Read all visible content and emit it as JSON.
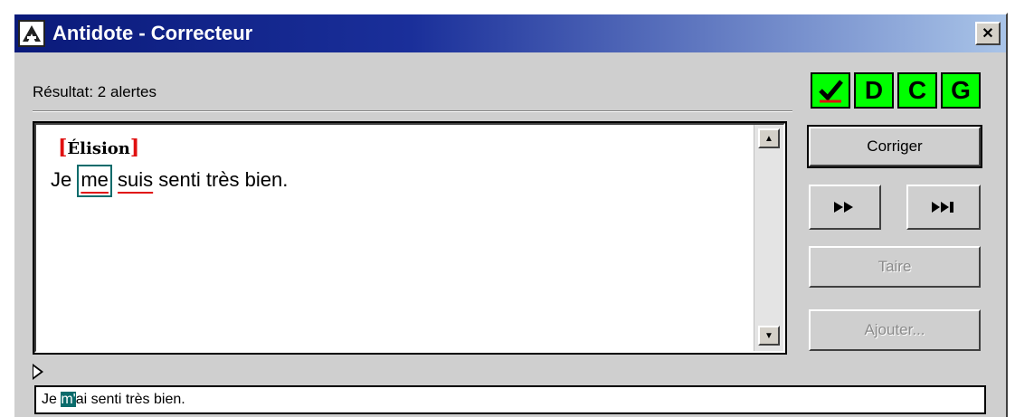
{
  "window": {
    "title": "Antidote - Correcteur",
    "close_glyph": "✕"
  },
  "result": {
    "label": "Résultat: 2 alertes"
  },
  "mode_buttons": [
    {
      "label": "✔",
      "icon": "check-icon"
    },
    {
      "label": "D",
      "icon": "d-letter-icon"
    },
    {
      "label": "C",
      "icon": "c-letter-icon"
    },
    {
      "label": "G",
      "icon": "g-letter-icon"
    }
  ],
  "editor": {
    "alert_bracket_open": "[",
    "alert_label": "Élision",
    "alert_bracket_close": "]",
    "sentence": {
      "before": "Je ",
      "word1": "me",
      "between": " ",
      "word2": "suis",
      "after": " senti très bien."
    }
  },
  "buttons": {
    "correct": "Corriger",
    "next": "▶▶",
    "last": "▶▶|",
    "ignore": "Taire",
    "add": "Ajouter..."
  },
  "preview": {
    "before": "Je ",
    "highlight": "m'",
    "after": "ai senti très bien."
  },
  "colors": {
    "title_start": "#0a1a7a",
    "title_end": "#a9c4e8",
    "mode_button_bg": "#00ff00",
    "error_underline": "#e01010",
    "focus_box": "#0a6b6b"
  }
}
